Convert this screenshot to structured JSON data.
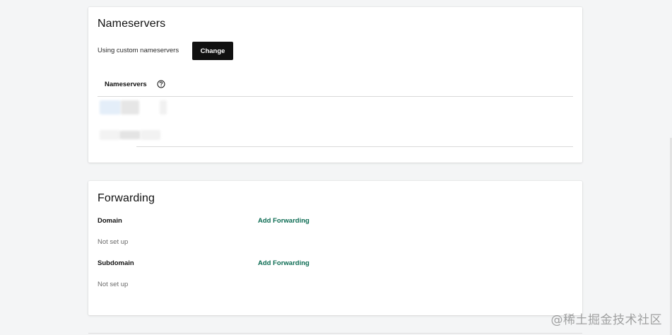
{
  "nameservers": {
    "title": "Nameservers",
    "status_text": "Using custom nameservers",
    "change_label": "Change",
    "column_header": "Nameservers",
    "help_icon": "question-circle-icon"
  },
  "forwarding": {
    "title": "Forwarding",
    "items": [
      {
        "label": "Domain",
        "status": "Not set up",
        "action": "Add Forwarding"
      },
      {
        "label": "Subdomain",
        "status": "Not set up",
        "action": "Add Forwarding"
      }
    ]
  },
  "watermark": "@稀土掘金技术社区",
  "colors": {
    "page_bg": "#f4f5f6",
    "card_bg": "#ffffff",
    "button_bg": "#111111",
    "link": "#0b6b52"
  }
}
